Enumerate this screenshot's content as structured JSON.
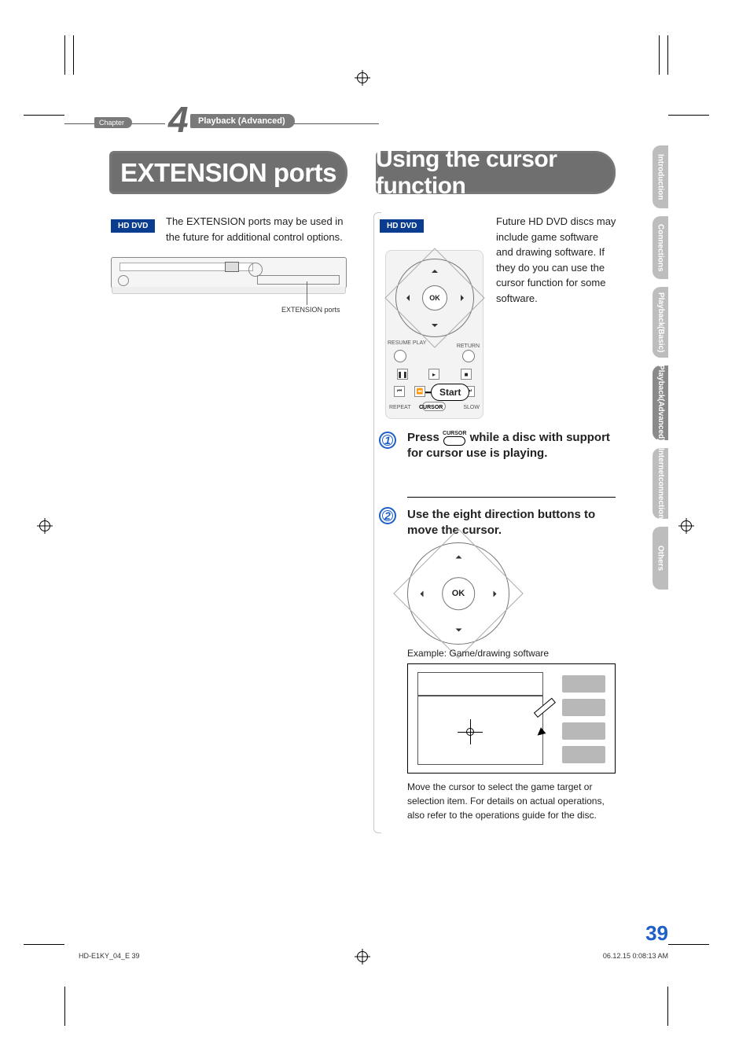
{
  "chapter": {
    "label": "Chapter",
    "number": "4",
    "title": "Playback (Advanced)"
  },
  "sections": {
    "extension": {
      "title": "EXTENSION ports",
      "badge": "HD DVD",
      "desc": "The EXTENSION ports may be used in the future for additional control options.",
      "illustration_label": "EXTENSION ports"
    },
    "cursor": {
      "title": "Using the cursor function",
      "badge": "HD DVD",
      "desc": "Future HD DVD discs may include game software and drawing software. If they do you can use the cursor function for some software.",
      "remote": {
        "ok": "OK",
        "resume": "RESUME PLAY",
        "return": "RETURN",
        "repeat": "REPEAT",
        "cursor": "CURSOR",
        "slow": "SLOW",
        "start_callout": "Start"
      },
      "steps": {
        "s1_pre": "Press ",
        "s1_btn": "CURSOR",
        "s1_post": " while a disc with support for cursor use is playing.",
        "s2": "Use the eight direction buttons to move the cursor."
      },
      "dpad_ok": "OK",
      "example_label": "Example: Game/drawing software",
      "example_note": "Move the cursor to select the game target or selection item. For details on actual operations, also refer to the operations guide for the disc."
    }
  },
  "side_tabs": {
    "intro": "Introduction",
    "conn": "Connections",
    "pb_basic_a": "Playback",
    "pb_basic_b": "(Basic)",
    "pb_adv_a": "Playback",
    "pb_adv_b": "(Advanced)",
    "net_a": "Internet",
    "net_b": "connection",
    "others": "Others"
  },
  "page_number": "39",
  "footer": {
    "id": "HD-E1KY_04_E   39",
    "timestamp": "06.12.15  0:08:13 AM"
  }
}
